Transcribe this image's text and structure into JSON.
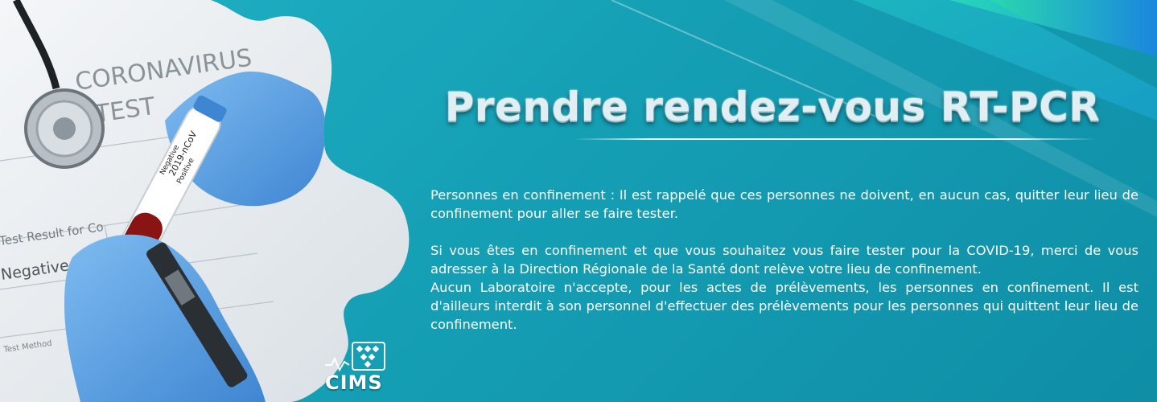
{
  "banner": {
    "title": "Prendre rendez-vous RT-PCR",
    "paragraphs": [
      "Personnes en confinement : Il est rappelé que ces personnes ne doivent, en aucun cas, quitter leur lieu de confinement pour aller se faire tester.",
      "Si vous êtes en confinement et que vous souhaitez vous faire tester pour la COVID-19, merci de vous adresser à la Direction Régionale de la Santé dont relève votre lieu de confinement.",
      "Aucun Laboratoire n'accepte, pour les actes de prélèvements, les personnes en confinement. Il est d'ailleurs interdit à son personnel d'effectuer des prélèvements pour les personnes qui quittent leur lieu de confinement."
    ]
  },
  "photo": {
    "form_title_line1": "CORONAVIRUS",
    "form_title_line2": "TEST",
    "form_result_label": "Test Result for Co",
    "form_negative": "Negative",
    "form_method": "Test Method",
    "tube_label": "2019-nCoV",
    "tube_negative": "Negative",
    "tube_positive": "Positive"
  },
  "logo": {
    "text": "CIMS"
  },
  "colors": {
    "background": "#159fb5",
    "accent_green": "#2ee6a0",
    "accent_blue": "#1a7fd8",
    "glove": "#5aa3e6",
    "text": "#ffffff"
  }
}
